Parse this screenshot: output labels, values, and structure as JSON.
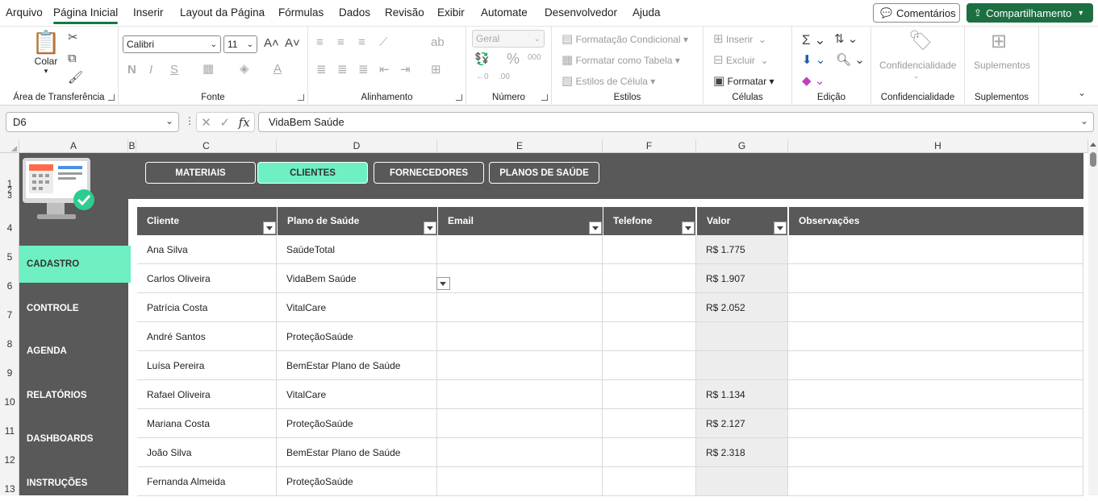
{
  "menu": {
    "items": [
      "Arquivo",
      "Página Inicial",
      "Inserir",
      "Layout da Página",
      "Fórmulas",
      "Dados",
      "Revisão",
      "Exibir",
      "Automate",
      "Desenvolvedor",
      "Ajuda"
    ],
    "active": "Página Inicial",
    "comments_label": "Comentários",
    "share_label": "Compartilhamento"
  },
  "ribbon": {
    "clipboard": {
      "paste_label": "Colar",
      "group_label": "Área de Transferência"
    },
    "font": {
      "font_name": "Calibri",
      "font_size": "11",
      "bold": "N",
      "italic": "I",
      "underline": "S",
      "group_label": "Fonte"
    },
    "alignment": {
      "group_label": "Alinhamento"
    },
    "number": {
      "format": "Geral",
      "group_label": "Número"
    },
    "styles": {
      "conditional": "Formatação Condicional",
      "as_table": "Formatar como Tabela",
      "cell_styles": "Estilos de Célula",
      "group_label": "Estilos"
    },
    "cells": {
      "insert": "Inserir",
      "delete": "Excluir",
      "format": "Formatar",
      "group_label": "Células"
    },
    "editing": {
      "group_label": "Edição"
    },
    "sensitivity": {
      "label": "Confidencialidade",
      "group_label": "Confidencialidade"
    },
    "addins": {
      "label": "Suplementos",
      "group_label": "Suplementos"
    }
  },
  "formula_bar": {
    "name_box": "D6",
    "fx": "fx",
    "value": "VidaBem Saúde"
  },
  "columns": [
    "A",
    "B",
    "C",
    "D",
    "E",
    "F",
    "G",
    "H"
  ],
  "rows": [
    "1",
    "2",
    "3",
    "4",
    "5",
    "6",
    "7",
    "8",
    "9",
    "10",
    "11",
    "12",
    "13"
  ],
  "nav_tabs": [
    "MATERIAIS",
    "CLIENTES",
    "FORNECEDORES",
    "PLANOS DE SAÚDE"
  ],
  "nav_active": "CLIENTES",
  "sidebar": [
    "CADASTRO",
    "CONTROLE",
    "AGENDA",
    "RELATÓRIOS",
    "DASHBOARDS",
    "INSTRUÇÕES"
  ],
  "sidebar_active": "CADASTRO",
  "table": {
    "headers": [
      "Cliente",
      "Plano de Saúde",
      "Email",
      "Telefone",
      "Valor",
      "Observações"
    ],
    "rows": [
      [
        "Ana Silva",
        "SaúdeTotal",
        "",
        "",
        "R$ 1.775",
        ""
      ],
      [
        "Carlos Oliveira",
        "VidaBem Saúde",
        "",
        "",
        "R$ 1.907",
        ""
      ],
      [
        "Patrícia Costa",
        "VitalCare",
        "",
        "",
        "R$ 2.052",
        ""
      ],
      [
        "André Santos",
        "ProteçãoSaúde",
        "",
        "",
        "",
        ""
      ],
      [
        "Luísa Pereira",
        "BemEstar Plano de Saúde",
        "",
        "",
        "",
        ""
      ],
      [
        "Rafael Oliveira",
        "VitalCare",
        "",
        "",
        "R$ 1.134",
        ""
      ],
      [
        "Mariana Costa",
        "ProteçãoSaúde",
        "",
        "",
        "R$ 2.127",
        ""
      ],
      [
        "João Silva",
        "BemEstar Plano de Saúde",
        "",
        "",
        "R$ 2.318",
        ""
      ],
      [
        "Fernanda Almeida",
        "ProteçãoSaúde",
        "",
        "",
        "",
        ""
      ]
    ]
  },
  "colors": {
    "accent": "#6ef0c2",
    "dark": "#595959",
    "excel_green": "#1d6f42"
  }
}
